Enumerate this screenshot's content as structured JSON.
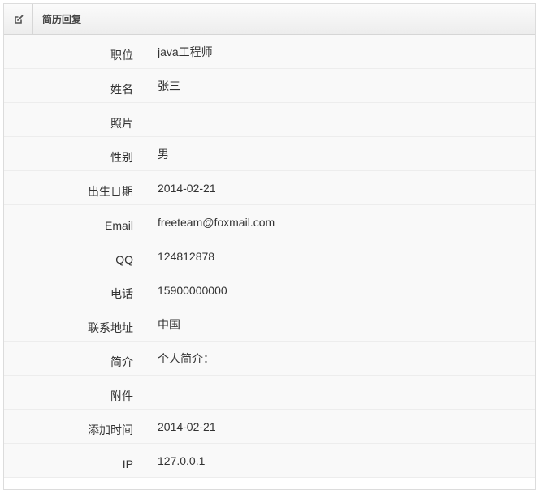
{
  "panel": {
    "title": "简历回复",
    "header_icon": "edit-icon"
  },
  "fields": [
    {
      "label": "职位",
      "value": "java工程师"
    },
    {
      "label": "姓名",
      "value": "张三"
    },
    {
      "label": "照片",
      "value": ""
    },
    {
      "label": "性别",
      "value": "男"
    },
    {
      "label": "出生日期",
      "value": "2014-02-21"
    },
    {
      "label": "Email",
      "value": "freeteam@foxmail.com"
    },
    {
      "label": "QQ",
      "value": "124812878"
    },
    {
      "label": "电话",
      "value": "15900000000"
    },
    {
      "label": "联系地址",
      "value": "中国"
    },
    {
      "label": "简介",
      "value": "个人简介："
    },
    {
      "label": "附件",
      "value": ""
    },
    {
      "label": "添加时间",
      "value": "2014-02-21"
    },
    {
      "label": "IP",
      "value": "127.0.0.1"
    }
  ]
}
